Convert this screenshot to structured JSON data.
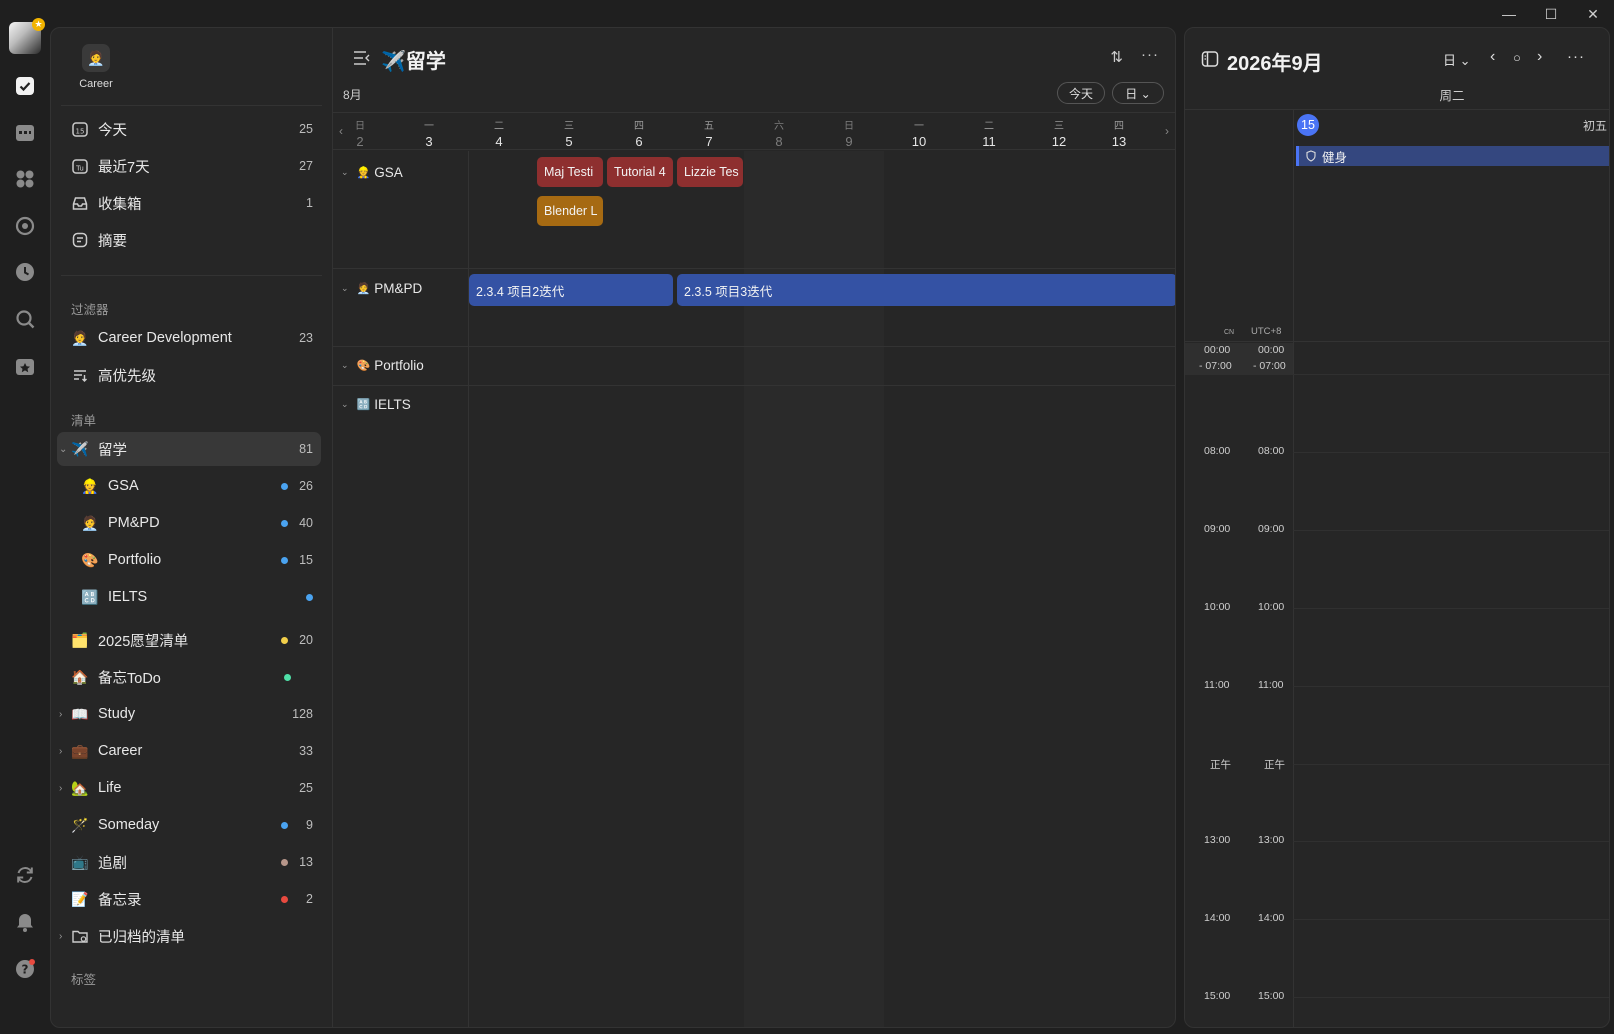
{
  "window": {
    "minimize": "—",
    "maximize": "☐",
    "close": "✕"
  },
  "account": {
    "name": "Career",
    "avatar_emoji": "🧑‍💼"
  },
  "smart_lists": [
    {
      "label": "今天",
      "count": "25",
      "icon": "calendar-15-icon"
    },
    {
      "label": "最近7天",
      "count": "27",
      "icon": "calendar-week-icon"
    },
    {
      "label": "收集箱",
      "count": "1",
      "icon": "inbox-icon"
    },
    {
      "label": "摘要",
      "count": "",
      "icon": "summary-icon"
    }
  ],
  "filters_label": "过滤器",
  "filters": [
    {
      "label": "Career Development",
      "count": "23",
      "emoji": "🧑‍💼"
    },
    {
      "label": "高优先级",
      "count": "",
      "icon": "priority-filter-icon"
    }
  ],
  "lists_label": "清单",
  "lists": [
    {
      "label": "留学",
      "count": "81",
      "emoji": "✈️",
      "active": true,
      "chevron": "⌄"
    },
    {
      "label": "GSA",
      "count": "26",
      "emoji": "👷",
      "dot": "#4aa3f0",
      "sub": true
    },
    {
      "label": "PM&PD",
      "count": "40",
      "emoji": "🧑‍💼",
      "dot": "#4aa3f0",
      "sub": true
    },
    {
      "label": "Portfolio",
      "count": "15",
      "emoji": "🎨",
      "dot": "#4aa3f0",
      "sub": true
    },
    {
      "label": "IELTS",
      "count": "",
      "emoji": "🔠",
      "dot": "#4aa3f0",
      "sub": true
    },
    {
      "label": "2025愿望清单",
      "count": "20",
      "emoji": "🗂️",
      "dot": "#f2cf4a"
    },
    {
      "label": "备忘ToDo",
      "count": "",
      "emoji": "🏠",
      "dot": "#4fe0a8"
    },
    {
      "label": "Study",
      "count": "128",
      "emoji": "📖",
      "chevron": "›"
    },
    {
      "label": "Career",
      "count": "33",
      "emoji": "💼",
      "chevron": "›"
    },
    {
      "label": "Life",
      "count": "25",
      "emoji": "🏡",
      "chevron": "›"
    },
    {
      "label": "Someday",
      "count": "9",
      "emoji": "🪄",
      "dot": "#4aa3f0"
    },
    {
      "label": "追剧",
      "count": "13",
      "emoji": "📺",
      "dot": "#b7968a"
    },
    {
      "label": "备忘录",
      "count": "2",
      "emoji": "📝",
      "dot": "#e84a3f"
    },
    {
      "label": "已归档的清单",
      "count": "",
      "icon": "archive-folder-icon",
      "chevron": "›"
    }
  ],
  "tags_label": "标签",
  "content": {
    "title": "留学",
    "title_emoji": "✈️",
    "month": "8月",
    "today_button": "今天",
    "view_button": "日 ⌄",
    "sort_icon": "⇅",
    "more_icon": "···",
    "prev": "‹",
    "next": "›",
    "days": [
      {
        "wd": "日",
        "dn": "2",
        "dim": true
      },
      {
        "wd": "一",
        "dn": "3"
      },
      {
        "wd": "二",
        "dn": "4"
      },
      {
        "wd": "三",
        "dn": "5"
      },
      {
        "wd": "四",
        "dn": "6"
      },
      {
        "wd": "五",
        "dn": "7"
      },
      {
        "wd": "六",
        "dn": "8",
        "dim": true
      },
      {
        "wd": "日",
        "dn": "9",
        "dim": true
      },
      {
        "wd": "一",
        "dn": "10"
      },
      {
        "wd": "二",
        "dn": "11"
      },
      {
        "wd": "三",
        "dn": "12"
      },
      {
        "wd": "四",
        "dn": "13"
      }
    ],
    "rows": [
      {
        "label": "GSA",
        "emoji": "👷"
      },
      {
        "label": "PM&PD",
        "emoji": "🧑‍💼"
      },
      {
        "label": "Portfolio",
        "emoji": "🎨"
      },
      {
        "label": "IELTS",
        "emoji": "🔠"
      }
    ],
    "events": {
      "maj": "Maj Testi",
      "tutorial": "Tutorial 4",
      "lizzie": "Lizzie Tes",
      "blender": "Blender L",
      "iter2": "2.3.4 项目2迭代",
      "iter3": "2.3.5 项目3迭代"
    }
  },
  "right": {
    "title": "2026年9月",
    "view": "日 ⌄",
    "prev": "‹",
    "today_dot": "○",
    "next": "›",
    "more": "···",
    "weekday": "周二",
    "date": "15",
    "lunar": "初五",
    "allday_event": "健身",
    "tz_left": "CN",
    "tz_right": "UTC+8",
    "early_start": "00:00",
    "early_end": "- 07:00",
    "hours": [
      "08:00",
      "09:00",
      "10:00",
      "11:00",
      "正午",
      "13:00",
      "14:00",
      "15:00"
    ]
  }
}
